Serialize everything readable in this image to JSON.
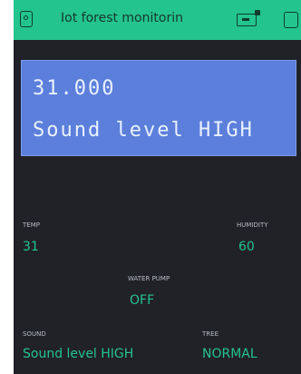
{
  "topbar": {
    "title": "Iot forest monitorin",
    "background": "#23c48e",
    "icons": [
      "project-icon",
      "device-icon",
      "stop-icon"
    ]
  },
  "lcd": {
    "line1": "31.000",
    "line2": "Sound level HIGH",
    "background": "#5b7fdb"
  },
  "widgets": {
    "temp": {
      "label": "TEMP",
      "value": "31"
    },
    "humidity": {
      "label": "HUMIDITY",
      "value": "60"
    },
    "water_pump": {
      "label": "WATER PUMP",
      "value": "OFF"
    },
    "sound": {
      "label": "SOUND",
      "value": "Sound level HIGH"
    },
    "tree": {
      "label": "TREE",
      "value": "NORMAL"
    }
  },
  "colors": {
    "accent": "#23c48e",
    "screen_bg": "#212227"
  }
}
